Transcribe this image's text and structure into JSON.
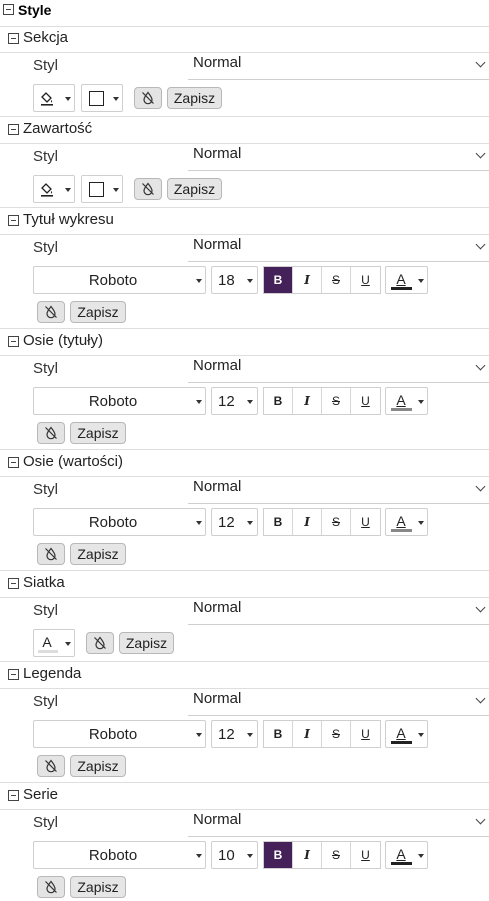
{
  "panel": {
    "title": "Style"
  },
  "common": {
    "style_label": "Styl",
    "style_value": "Normal",
    "save_label": "Zapisz",
    "font_color_glyph": "A",
    "format": {
      "bold": "B",
      "italic": "I",
      "strike": "S",
      "underline": "U"
    }
  },
  "sections": {
    "sekcja": {
      "title": "Sekcja"
    },
    "zawartosc": {
      "title": "Zawartość"
    },
    "tytul": {
      "title": "Tytuł wykresu",
      "font": "Roboto",
      "size": "18",
      "bold_active": true
    },
    "osie_tytuly": {
      "title": "Osie (tytuły)",
      "font": "Roboto",
      "size": "12"
    },
    "osie_wartosci": {
      "title": "Osie (wartości)",
      "font": "Roboto",
      "size": "12"
    },
    "siatka": {
      "title": "Siatka"
    },
    "legenda": {
      "title": "Legenda",
      "font": "Roboto",
      "size": "12"
    },
    "serie": {
      "title": "Serie",
      "font": "Roboto",
      "size": "10",
      "bold_active": true
    }
  },
  "colors": {
    "accent": "#45215a",
    "dark_swatch": "#222222",
    "gray_swatch": "#888888",
    "light_swatch": "#dddddd"
  },
  "icons": {
    "collapse": "minus-square-icon",
    "fill": "paint-bucket-icon",
    "border": "border-square-icon",
    "reset": "no-drop-icon",
    "dropdown": "chevron-down-icon"
  }
}
